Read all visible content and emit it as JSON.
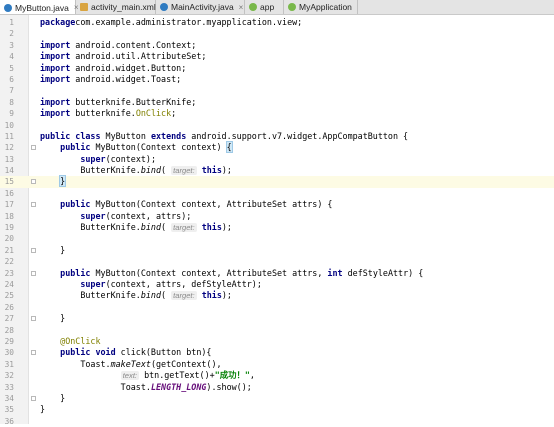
{
  "tabs": [
    {
      "label": "MyButton.java",
      "icon": "java-class-icon",
      "active": true
    },
    {
      "label": "activity_main.xml",
      "icon": "xml-file-icon",
      "active": false
    },
    {
      "label": "MainActivity.java",
      "icon": "java-class-icon",
      "active": false
    },
    {
      "label": "app",
      "icon": "android-module-icon",
      "active": false
    },
    {
      "label": "MyApplication",
      "icon": "android-module-icon",
      "active": false
    }
  ],
  "editor": {
    "current_line": 15,
    "lines": [
      {
        "n": "1",
        "segs": [
          [
            "kw",
            "package"
          ],
          [
            "",
            "com.example.administrator.myapplication.view;"
          ]
        ]
      },
      {
        "n": "2",
        "segs": []
      },
      {
        "n": "3",
        "segs": [
          [
            "kw",
            "import"
          ],
          [
            "",
            " android.content.Context;"
          ]
        ]
      },
      {
        "n": "4",
        "segs": [
          [
            "kw",
            "import"
          ],
          [
            "",
            " android.util.AttributeSet;"
          ]
        ]
      },
      {
        "n": "5",
        "segs": [
          [
            "kw",
            "import"
          ],
          [
            "",
            " android.widget.Button;"
          ]
        ]
      },
      {
        "n": "6",
        "segs": [
          [
            "kw",
            "import"
          ],
          [
            "",
            " android.widget.Toast;"
          ]
        ]
      },
      {
        "n": "7",
        "segs": []
      },
      {
        "n": "8",
        "segs": [
          [
            "kw",
            "import"
          ],
          [
            "",
            " butterknife.ButterKnife;"
          ]
        ]
      },
      {
        "n": "9",
        "segs": [
          [
            "kw",
            "import"
          ],
          [
            "",
            " butterknife."
          ],
          [
            "ann",
            "OnClick"
          ],
          [
            "",
            ";"
          ]
        ]
      },
      {
        "n": "10",
        "segs": []
      },
      {
        "n": "11",
        "segs": [
          [
            "kw",
            "public class"
          ],
          [
            "",
            " MyButton "
          ],
          [
            "kw",
            "extends"
          ],
          [
            "",
            " android.support.v7.widget.AppCompatButton {"
          ]
        ]
      },
      {
        "n": "12",
        "segs": [
          [
            "",
            "    "
          ],
          [
            "kw",
            "public"
          ],
          [
            "",
            " MyButton(Context context) "
          ],
          [
            "brace",
            "{"
          ]
        ]
      },
      {
        "n": "13",
        "segs": [
          [
            "",
            "        "
          ],
          [
            "kw",
            "super"
          ],
          [
            "",
            "(context);"
          ]
        ]
      },
      {
        "n": "14",
        "segs": [
          [
            "",
            "        ButterKnife."
          ],
          [
            "it",
            "bind"
          ],
          [
            "",
            "( "
          ],
          [
            "hint",
            "target:"
          ],
          [
            "",
            " "
          ],
          [
            "kw",
            "this"
          ],
          [
            "",
            ");"
          ]
        ]
      },
      {
        "n": "15",
        "segs": [
          [
            "",
            "    "
          ],
          [
            "brace",
            "}"
          ],
          [
            "caret",
            ""
          ]
        ]
      },
      {
        "n": "16",
        "segs": []
      },
      {
        "n": "17",
        "segs": [
          [
            "",
            "    "
          ],
          [
            "kw",
            "public"
          ],
          [
            "",
            " MyButton(Context context, AttributeSet attrs) {"
          ]
        ]
      },
      {
        "n": "18",
        "segs": [
          [
            "",
            "        "
          ],
          [
            "kw",
            "super"
          ],
          [
            "",
            "(context, attrs);"
          ]
        ]
      },
      {
        "n": "19",
        "segs": [
          [
            "",
            "        ButterKnife."
          ],
          [
            "it",
            "bind"
          ],
          [
            "",
            "( "
          ],
          [
            "hint",
            "target:"
          ],
          [
            "",
            " "
          ],
          [
            "kw",
            "this"
          ],
          [
            "",
            ");"
          ]
        ]
      },
      {
        "n": "20",
        "segs": []
      },
      {
        "n": "21",
        "segs": [
          [
            "",
            "    }"
          ]
        ]
      },
      {
        "n": "22",
        "segs": []
      },
      {
        "n": "23",
        "segs": [
          [
            "",
            "    "
          ],
          [
            "kw",
            "public"
          ],
          [
            "",
            " MyButton(Context context, AttributeSet attrs, "
          ],
          [
            "kw",
            "int"
          ],
          [
            "",
            " defStyleAttr) {"
          ]
        ]
      },
      {
        "n": "24",
        "segs": [
          [
            "",
            "        "
          ],
          [
            "kw",
            "super"
          ],
          [
            "",
            "(context, attrs, defStyleAttr);"
          ]
        ]
      },
      {
        "n": "25",
        "segs": [
          [
            "",
            "        ButterKnife."
          ],
          [
            "it",
            "bind"
          ],
          [
            "",
            "( "
          ],
          [
            "hint",
            "target:"
          ],
          [
            "",
            " "
          ],
          [
            "kw",
            "this"
          ],
          [
            "",
            ");"
          ]
        ]
      },
      {
        "n": "26",
        "segs": []
      },
      {
        "n": "27",
        "segs": [
          [
            "",
            "    }"
          ]
        ]
      },
      {
        "n": "28",
        "segs": []
      },
      {
        "n": "29",
        "segs": [
          [
            "",
            "    "
          ],
          [
            "ann",
            "@OnClick"
          ]
        ]
      },
      {
        "n": "30",
        "segs": [
          [
            "",
            "    "
          ],
          [
            "kw",
            "public void"
          ],
          [
            "",
            " click(Button btn){"
          ]
        ]
      },
      {
        "n": "31",
        "segs": [
          [
            "",
            "        Toast."
          ],
          [
            "it",
            "makeText"
          ],
          [
            "",
            "(getContext(),"
          ]
        ]
      },
      {
        "n": "32",
        "segs": [
          [
            "",
            "                "
          ],
          [
            "hint",
            "text:"
          ],
          [
            "",
            " btn.getText()+"
          ],
          [
            "str",
            "\"成功！\""
          ],
          [
            "",
            ","
          ]
        ]
      },
      {
        "n": "33",
        "segs": [
          [
            "",
            "                Toast."
          ],
          [
            "st",
            "LENGTH_LONG"
          ],
          [
            "",
            ").show();"
          ]
        ]
      },
      {
        "n": "34",
        "segs": [
          [
            "",
            "    }"
          ]
        ]
      },
      {
        "n": "35",
        "segs": [
          [
            "",
            "}"
          ]
        ]
      },
      {
        "n": "36",
        "segs": []
      }
    ],
    "fold_lines": [
      "12",
      "15",
      "17",
      "21",
      "23",
      "27",
      "30",
      "34"
    ]
  }
}
